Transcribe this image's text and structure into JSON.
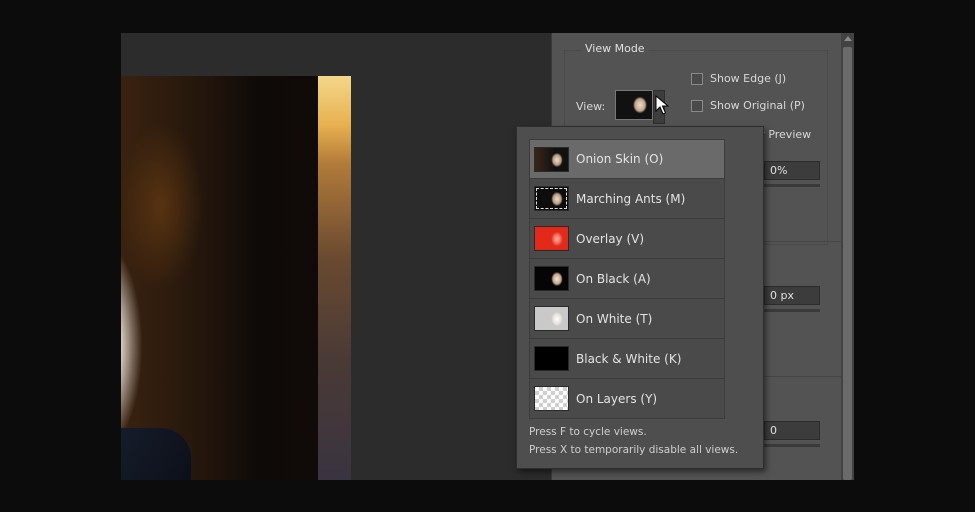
{
  "view_mode": {
    "section_title": "View Mode",
    "view_label": "View:",
    "show_edge": "Show Edge (J)",
    "show_original": "Show Original (P)",
    "quality_preview": "ty Preview"
  },
  "fields": {
    "field1": "0%",
    "field2": "0 px",
    "field3": "0"
  },
  "dropdown": {
    "items": [
      {
        "label": "Onion Skin (O)",
        "thumb": "onion-skin-thumb",
        "selected": true
      },
      {
        "label": "Marching Ants (M)",
        "thumb": "marching-ants-thumb"
      },
      {
        "label": "Overlay (V)",
        "thumb": "overlay-thumb"
      },
      {
        "label": "On Black (A)",
        "thumb": "on-black-thumb"
      },
      {
        "label": "On White (T)",
        "thumb": "on-white-thumb"
      },
      {
        "label": "Black & White (K)",
        "thumb": "black-white-thumb"
      },
      {
        "label": "On Layers (Y)",
        "thumb": "on-layers-thumb"
      }
    ],
    "hint1": "Press F to cycle views.",
    "hint2": "Press X to temporarily disable all views."
  },
  "colors": {
    "panel": "#535353",
    "selected_item": "#6a6a6a",
    "overlay_red": "#e32a1a"
  }
}
